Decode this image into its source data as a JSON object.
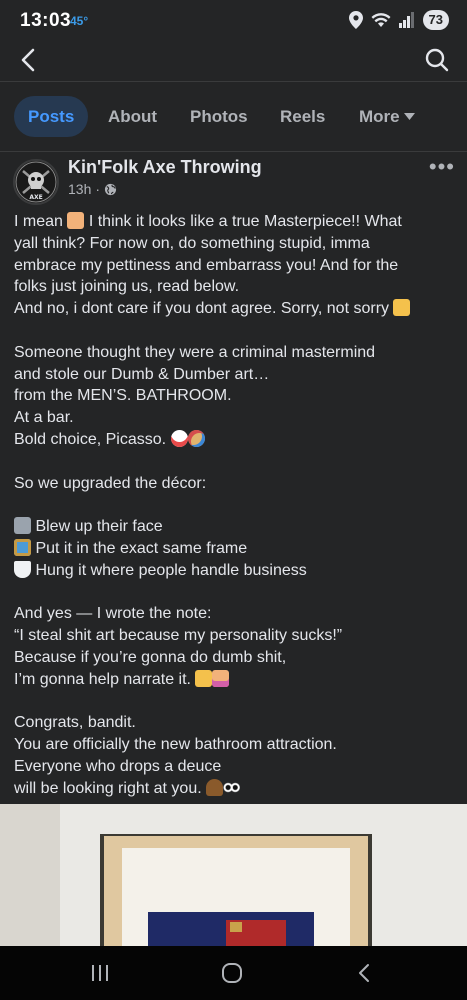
{
  "status_bar": {
    "time": "13:03",
    "temperature": "45°",
    "battery": "73"
  },
  "nav": {
    "back_icon": "chevron-left-icon",
    "search_icon": "search-icon"
  },
  "tabs": [
    {
      "label": "Posts",
      "active": true
    },
    {
      "label": "About",
      "active": false
    },
    {
      "label": "Photos",
      "active": false
    },
    {
      "label": "Reels",
      "active": false
    },
    {
      "label": "More",
      "active": false
    }
  ],
  "post": {
    "page_name": "Kin'Folk Axe Throwing",
    "timestamp": "13h",
    "separator": "·",
    "avatar_text": "AXE",
    "lines": [
      "I mean",
      "I think it looks like a true Masterpiece!! What",
      "yall think? For now on, do something stupid, imma",
      "embrace my pettiness and embarrass you! And for the",
      "folks just joining us, read below.",
      "And no, i dont care if you dont agree. Sorry, not sorry",
      "Someone thought they were a criminal mastermind",
      "and stole our Dumb & Dumber art…",
      "from the MEN’S. BATHROOM.",
      "At a bar.",
      "Bold choice, Picasso.",
      "So we upgraded the décor:",
      "Blew up their face",
      "Put it in the exact same frame",
      "Hung it where people handle business",
      "And yes — I wrote the note:",
      "“I steal shit art because my personality sucks!”",
      "Because if you’re gonna do dumb shit,",
      "I’m gonna help narrate it.",
      "Congrats, bandit.",
      "You are officially the new bathroom attraction.",
      "Everyone who drops a deuce",
      "will be looking right at you."
    ]
  },
  "colors": {
    "background": "#242526",
    "accent": "#4599ff",
    "active_tab_bg": "#263951",
    "text": "#e4e6eb",
    "muted": "#b0b3b8"
  }
}
